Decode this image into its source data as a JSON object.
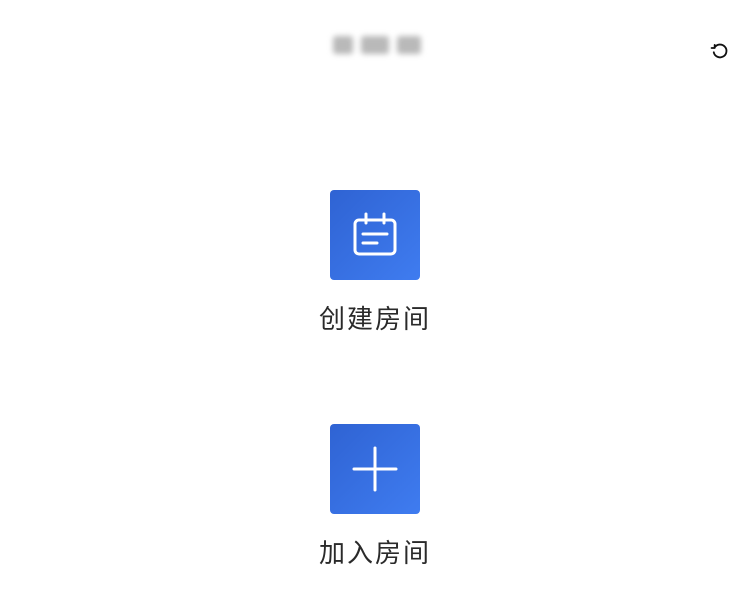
{
  "header": {
    "title_blurred": true,
    "refresh_icon": "refresh-icon"
  },
  "actions": [
    {
      "id": "create",
      "label": "创建房间",
      "icon": "calendar-note-icon",
      "color": "#3470e4"
    },
    {
      "id": "join",
      "label": "加入房间",
      "icon": "plus-icon",
      "color": "#3470e4"
    }
  ]
}
